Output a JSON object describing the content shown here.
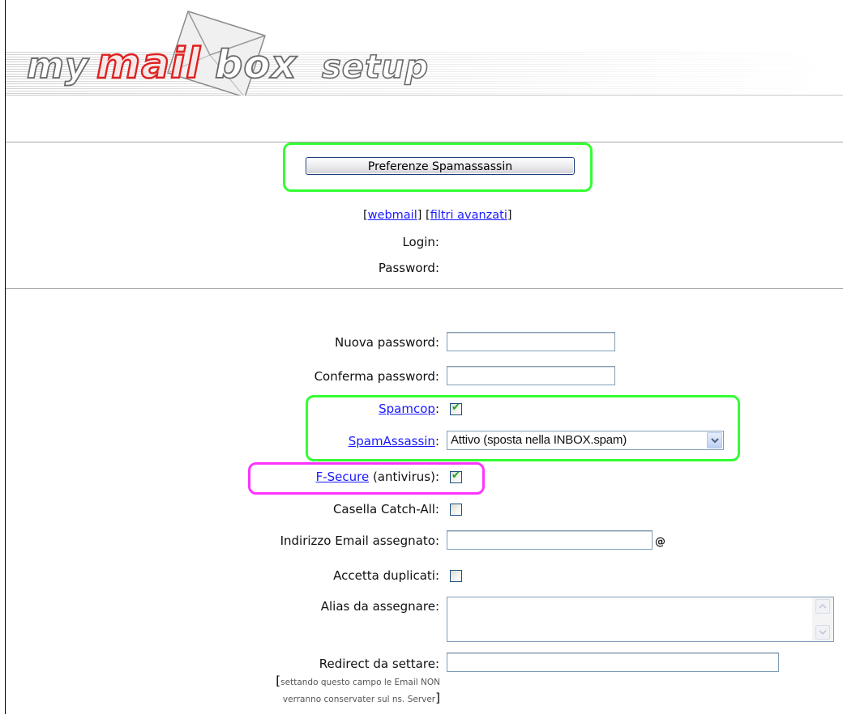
{
  "header": {
    "logo_words": [
      "my",
      "mail",
      "box",
      "setup"
    ],
    "logo_colors": {
      "outline": "#6a6a6a",
      "accent": "#e02020",
      "envelope": "#e8e8e8"
    }
  },
  "preferences_button": {
    "label": "Preferenze Spamassassin"
  },
  "account_links": {
    "webmail": "webmail",
    "advanced_filters": "filtri avanzati"
  },
  "account_info": {
    "login_label": "Login:",
    "password_label": "Password:"
  },
  "form": {
    "new_password": {
      "label": "Nuova password:",
      "value": ""
    },
    "confirm_password": {
      "label": "Conferma password:",
      "value": ""
    },
    "spamcop": {
      "link": "Spamcop",
      "suffix": ":",
      "checked": true
    },
    "spamassassin": {
      "link": "SpamAssassin",
      "suffix": ":",
      "selected": "Attivo (sposta nella INBOX.spam)"
    },
    "fsecure": {
      "link": "F-Secure",
      "suffix": " (antivirus):",
      "checked": true
    },
    "catch_all": {
      "label": "Casella Catch-All:",
      "checked": false
    },
    "assigned_email": {
      "label": "Indirizzo Email assegnato:",
      "value": "",
      "at_sign": "@"
    },
    "accept_duplicates": {
      "label": "Accetta duplicati:",
      "checked": false
    },
    "aliases": {
      "label": "Alias da assegnare:",
      "value": ""
    },
    "redirect": {
      "label": "Redirect da settare:",
      "value": "",
      "note_line1": "settando questo campo le Email NON",
      "note_line2": "verranno conservater sul ns. Server",
      "bracket_open": "[",
      "bracket_close": "]"
    }
  },
  "highlight_colors": {
    "green": "#33ff33",
    "magenta": "#ff33ff"
  },
  "link_color": "#1a1aff"
}
